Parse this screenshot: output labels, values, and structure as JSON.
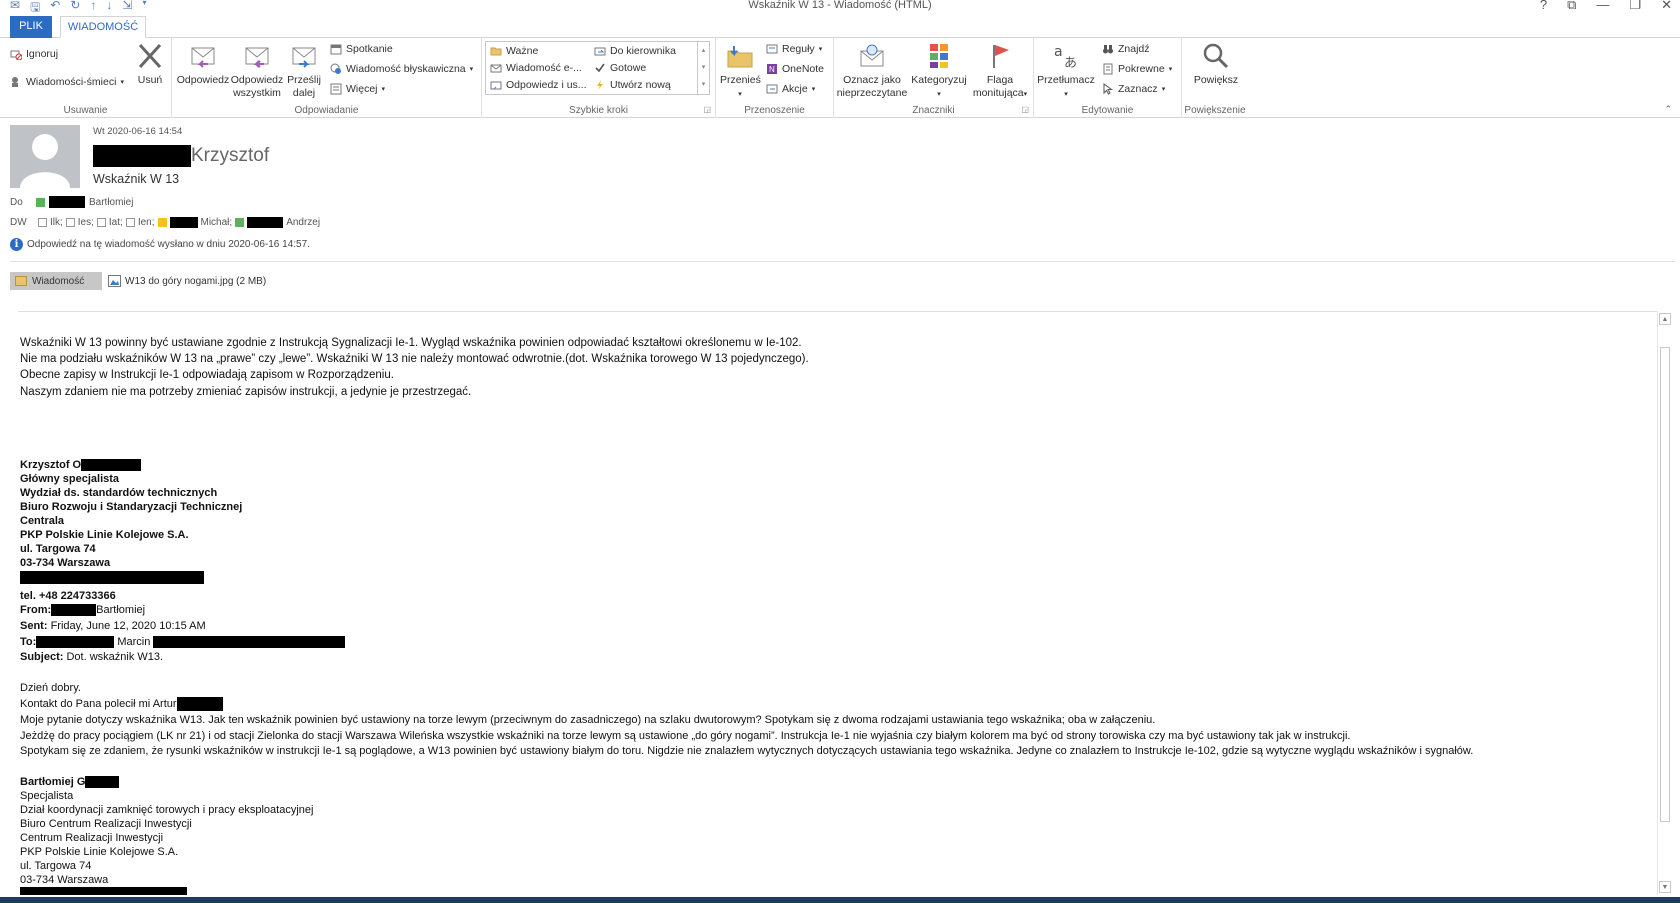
{
  "window": {
    "title": "Wskaźnik W 13 - Wiadomość (HTML)",
    "controls": [
      "?",
      "⧉",
      "—",
      "❐",
      "✕"
    ]
  },
  "tabs": {
    "plik": "PLIK",
    "wiadomosc": "WIADOMOŚĆ"
  },
  "ribbon": {
    "usuwanie": {
      "label": "Usuwanie",
      "ignoruj": "Ignoruj",
      "smieci": "Wiadomości-śmieci",
      "usun": "Usuń"
    },
    "odpowiadanie": {
      "label": "Odpowiadanie",
      "odpowiedz": "Odpowiedz",
      "odp_wszystkim_1": "Odpowiedz",
      "odp_wszystkim_2": "wszystkim",
      "przeslij_1": "Prześlij",
      "przeslij_2": "dalej",
      "spotkanie": "Spotkanie",
      "blyskawiczna": "Wiadomość błyskawiczna",
      "wiecej": "Więcej"
    },
    "szybkie_kroki": {
      "label": "Szybkie kroki",
      "wazne": "Ważne",
      "wiadomosc_e": "Wiadomość e-...",
      "odpowiedz_us": "Odpowiedz i us...",
      "do_kierownika": "Do kierownika",
      "gotowe": "Gotowe",
      "utworz_nowa": "Utwórz nową"
    },
    "przenoszenie": {
      "label": "Przenoszenie",
      "przenies": "Przenieś",
      "reguly": "Reguły",
      "onenote": "OneNote",
      "akcje": "Akcje"
    },
    "znaczniki": {
      "label": "Znaczniki",
      "oznacz_1": "Oznacz jako",
      "oznacz_2": "nieprzeczytane",
      "kategoryzuj": "Kategoryzuj",
      "flaga_1": "Flaga",
      "flaga_2": "monitująca"
    },
    "edytowanie": {
      "label": "Edytowanie",
      "przetlumacz": "Przetłumacz",
      "znajdz": "Znajdź",
      "pokrewne": "Pokrewne",
      "zaznacz": "Zaznacz"
    },
    "powiekszenie": {
      "label": "Powiększenie",
      "powieksz": "Powiększ"
    }
  },
  "header": {
    "date": "Wt 2020-06-16 14:54",
    "sender_name": "Krzysztof",
    "subject": "Wskaźnik W 13",
    "to_label": "Do",
    "to_name": "Bartłomiej",
    "cc_label": "DW",
    "cc": [
      "Ilk;",
      "Ies;",
      "Iat;",
      "Ien;"
    ],
    "cc_michal": "Michał;",
    "cc_andrzej": "Andrzej",
    "info": "Odpowiedź na tę wiadomość wysłano w dniu 2020-06-16 14:57."
  },
  "attachments": {
    "message": "Wiadomość",
    "file": "W13 do góry nogami.jpg (2 MB)"
  },
  "body": {
    "paragraphs": [
      "Wskaźniki W 13 powinny być ustawiane zgodnie z Instrukcją Sygnalizacji Ie-1. Wygląd wskaźnika powinien odpowiadać kształtowi określonemu w Ie-102.",
      "Nie ma podziału wskaźników W 13 na „prawe” czy „lewe”. Wskaźniki W 13 nie należy montować odwrotnie.(dot. Wskaźnika torowego W 13 pojedynczego).",
      "Obecne zapisy w Instrukcji Ie-1 odpowiadają zapisom w Rozporządzeniu.",
      "Naszym zdaniem nie ma potrzeby zmieniać zapisów instrukcji, a jedynie je przestrzegać."
    ],
    "signature": {
      "name": "Krzysztof O",
      "lines": [
        "Główny specjalista",
        "Wydział ds. standardów technicznych",
        "Biuro Rozwoju i Standaryzacji Technicznej",
        "Centrala",
        "PKP Polskie Linie Kolejowe S.A.",
        "ul. Targowa 74",
        "03-734 Warszawa"
      ],
      "tel": "tel. +48 224733366"
    },
    "forward": {
      "from_label": "From:",
      "from_value": "Bartłomiej",
      "sent_label": "Sent:",
      "sent_value": "Friday, June 12, 2020 10:15 AM",
      "to_label": "To:",
      "to_value": "Marcin",
      "subject_label": "Subject:",
      "subject_value": "Dot. wskaźnik W13."
    },
    "forward_body": [
      "Dzień dobry.",
      "Kontakt do Pana polecił mi Artur",
      "Moje pytanie dotyczy wskaźnika W13. Jak ten wskaźnik powinien być ustawiony na torze lewym (przeciwnym do zasadniczego) na szlaku dwutorowym? Spotykam się z dwoma rodzajami ustawiania tego wskaźnika; oba w załączeniu.",
      "Jeżdżę do pracy pociągiem (LK nr 21) i od stacji Zielonka do stacji Warszawa Wileńska wszystkie wskaźniki na torze lewym są ustawione „do góry nogami”. Instrukcja Ie-1 nie wyjaśnia czy białym kolorem ma być od strony torowiska czy ma być ustawiony tak jak w instrukcji.",
      "Spotykam się ze zdaniem, że rysunki wskaźników w instrukcji Ie-1 są poglądowe, a W13 powinien być ustawiony białym do toru. Nigdzie nie znalazłem wytycznych dotyczących ustawiania tego wskaźnika. Jedyne co znalazłem to Instrukcje Ie-102, gdzie są wytyczne wyglądu wskaźników i sygnałów."
    ],
    "signature2": {
      "name": "Bartłomiej G",
      "lines": [
        "Specjalista",
        "Dział koordynacji zamknięć torowych i pracy eksploatacyjnej",
        "Biuro Centrum Realizacji Inwestycji",
        "Centrum Realizacji Inwestycji",
        "PKP Polskie Linie Kolejowe S.A.",
        "ul. Targowa 74",
        "03-734 Warszawa"
      ]
    }
  },
  "colors": {
    "accent": "#2b6cc2",
    "flag": "#e0524a",
    "cat_green": "#59b35b",
    "cat_yellow": "#f2c31b"
  }
}
